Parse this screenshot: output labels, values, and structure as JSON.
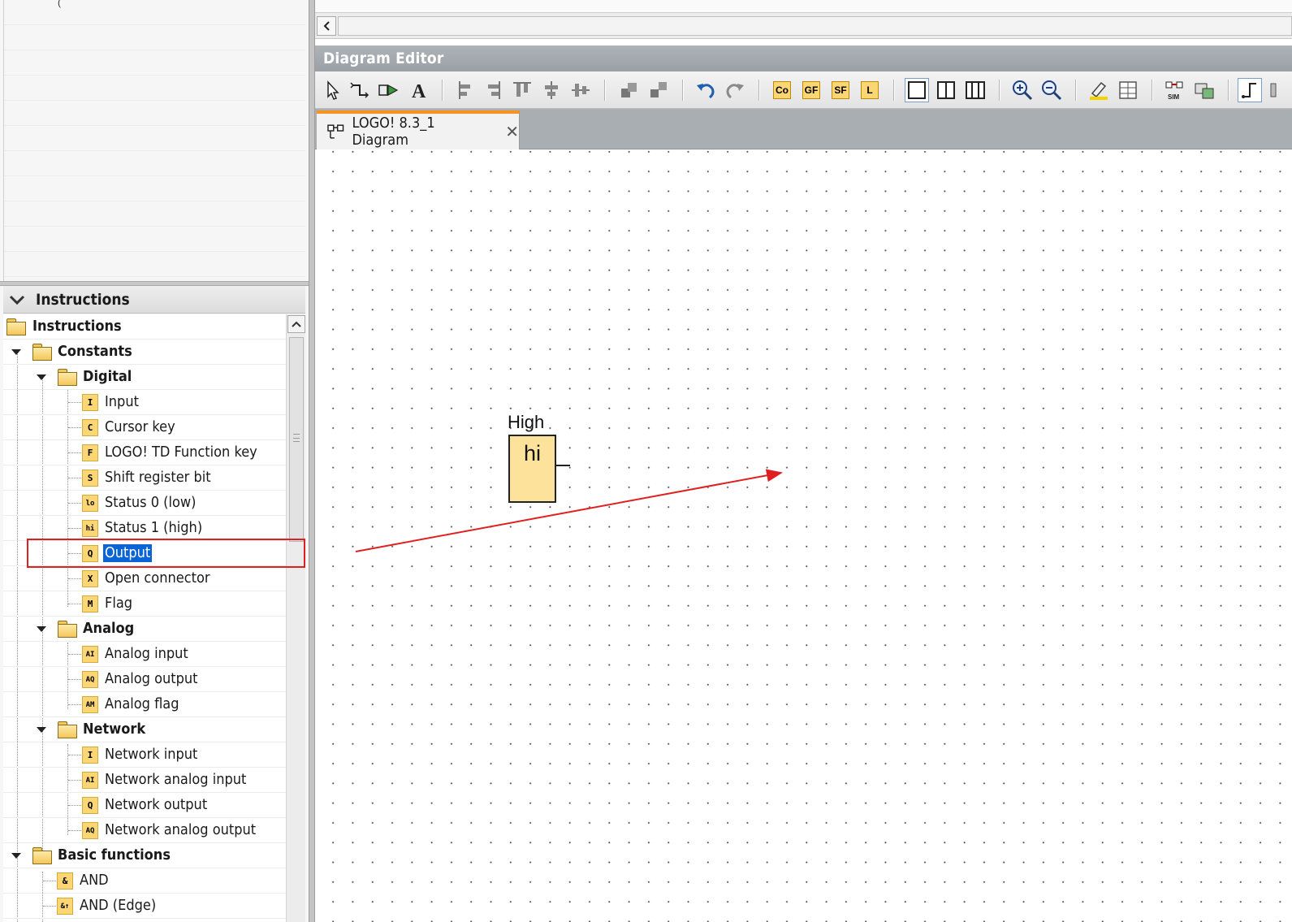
{
  "panel": {
    "header": "Instructions",
    "stray_glyph": "("
  },
  "tree": [
    {
      "label": "Instructions",
      "kind": "folder",
      "level": 0,
      "bold": true
    },
    {
      "label": "Constants",
      "kind": "folder",
      "level": 1,
      "bold": true,
      "expanded": true
    },
    {
      "label": "Digital",
      "kind": "folder",
      "level": 2,
      "bold": true,
      "expanded": true
    },
    {
      "label": "Input",
      "kind": "block",
      "level": 3,
      "badge": "I"
    },
    {
      "label": "Cursor key",
      "kind": "block",
      "level": 3,
      "badge": "C"
    },
    {
      "label": "LOGO! TD Function key",
      "kind": "block",
      "level": 3,
      "badge": "F"
    },
    {
      "label": "Shift register bit",
      "kind": "block",
      "level": 3,
      "badge": "S"
    },
    {
      "label": "Status 0 (low)",
      "kind": "block",
      "level": 3,
      "badge": "lo"
    },
    {
      "label": "Status 1 (high)",
      "kind": "block",
      "level": 3,
      "badge": "hi"
    },
    {
      "label": "Output",
      "kind": "block",
      "level": 3,
      "badge": "Q",
      "selected": true
    },
    {
      "label": "Open connector",
      "kind": "block",
      "level": 3,
      "badge": "X"
    },
    {
      "label": "Flag",
      "kind": "block",
      "level": 3,
      "badge": "M"
    },
    {
      "label": "Analog",
      "kind": "folder",
      "level": 2,
      "bold": true,
      "expanded": true
    },
    {
      "label": "Analog input",
      "kind": "block",
      "level": 3,
      "badge": "AI"
    },
    {
      "label": "Analog output",
      "kind": "block",
      "level": 3,
      "badge": "AQ"
    },
    {
      "label": "Analog flag",
      "kind": "block",
      "level": 3,
      "badge": "AM"
    },
    {
      "label": "Network",
      "kind": "folder",
      "level": 2,
      "bold": true,
      "expanded": true
    },
    {
      "label": "Network input",
      "kind": "block",
      "level": 3,
      "badge": "I"
    },
    {
      "label": "Network analog input",
      "kind": "block",
      "level": 3,
      "badge": "AI"
    },
    {
      "label": "Network output",
      "kind": "block",
      "level": 3,
      "badge": "Q"
    },
    {
      "label": "Network analog output",
      "kind": "block",
      "level": 3,
      "badge": "AQ"
    },
    {
      "label": "Basic functions",
      "kind": "folder",
      "level": 1,
      "bold": true,
      "expanded": true
    },
    {
      "label": "AND",
      "kind": "block",
      "level": 2,
      "badge": "&"
    },
    {
      "label": "AND (Edge)",
      "kind": "block",
      "level": 2,
      "badge": "&↑"
    }
  ],
  "editor": {
    "title": "Diagram Editor",
    "tab_label": "LOGO! 8.3_1 Diagram",
    "tab_close": "✕"
  },
  "toolbar": {
    "badges": {
      "co": "Co",
      "gf": "GF",
      "sf": "SF",
      "l": "L"
    },
    "icons": [
      "select-icon",
      "connect-icon",
      "block-icon",
      "text-icon",
      "align-left-icon",
      "align-right-icon",
      "align-top-icon",
      "align-h-icon",
      "align-v-icon",
      "group-icon",
      "ungroup-icon",
      "undo-icon",
      "redo-icon",
      "co-icon",
      "gf-icon",
      "sf-icon",
      "l-icon",
      "view-single-icon",
      "view-double-icon",
      "view-triple-icon",
      "zoom-in-icon",
      "zoom-out-icon",
      "highlight-icon",
      "table-icon",
      "simulation-icon",
      "online-test-icon",
      "route-icon"
    ]
  },
  "diagram": {
    "block_label": "High",
    "block_text": "hi"
  },
  "colors": {
    "block_fill": "#fde29b",
    "selection": "#0a64d6",
    "annotation": "#e02020",
    "tab_accent": "#f7931e"
  }
}
